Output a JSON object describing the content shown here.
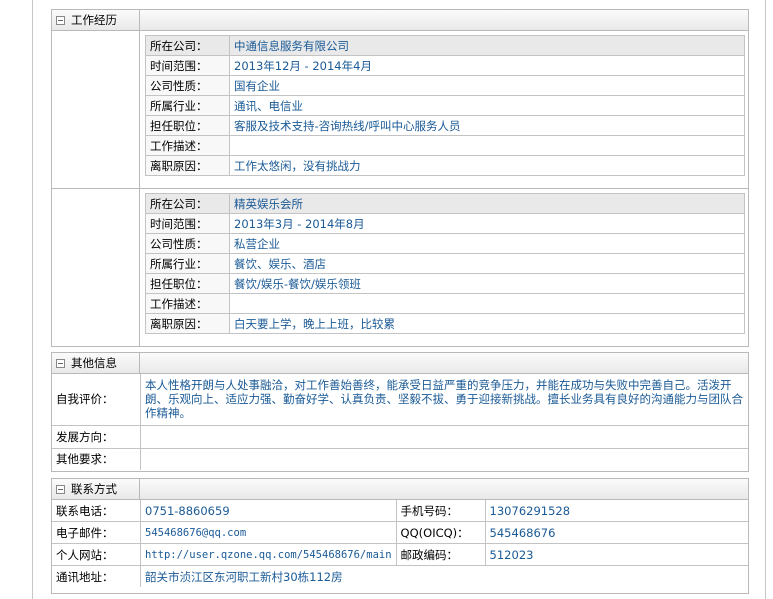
{
  "work": {
    "title": "工作经历",
    "jobs": [
      {
        "rows": [
          {
            "k": "所在公司：",
            "v": "中通信息服务有限公司"
          },
          {
            "k": "时间范围：",
            "v": "2013年12月 - 2014年4月"
          },
          {
            "k": "公司性质：",
            "v": "国有企业"
          },
          {
            "k": "所属行业：",
            "v": "通讯、电信业"
          },
          {
            "k": "担任职位：",
            "v": "客服及技术支持-咨询热线/呼叫中心服务人员"
          },
          {
            "k": "工作描述：",
            "v": ""
          },
          {
            "k": "离职原因：",
            "v": "工作太悠闲，没有挑战力"
          }
        ]
      },
      {
        "rows": [
          {
            "k": "所在公司：",
            "v": "精英娱乐会所"
          },
          {
            "k": "时间范围：",
            "v": "2013年3月 - 2014年8月"
          },
          {
            "k": "公司性质：",
            "v": "私营企业"
          },
          {
            "k": "所属行业：",
            "v": "餐饮、娱乐、酒店"
          },
          {
            "k": "担任职位：",
            "v": "餐饮/娱乐-餐饮/娱乐领班"
          },
          {
            "k": "工作描述：",
            "v": ""
          },
          {
            "k": "离职原因：",
            "v": "白天要上学，晚上上班，比较累"
          }
        ]
      }
    ]
  },
  "other": {
    "title": "其他信息",
    "self_eval_label": "自我评价：",
    "self_eval": "本人性格开朗与人处事融洽，对工作善始善终，能承受日益严重的竞争压力，并能在成功与失败中完善自己。活泼开朗、乐观向上、适应力强、勤奋好学、认真负责、坚毅不拔、勇于迎接新挑战。擅长业务具有良好的沟通能力与团队合作精神。",
    "direction_label": "发展方向：",
    "other_req_label": "其他要求："
  },
  "contact": {
    "title": "联系方式",
    "phone_label": "联系电话：",
    "phone": "0751-8860659",
    "mobile_label": "手机号码：",
    "mobile": "13076291528",
    "email_label": "电子邮件：",
    "email": "545468676@qq.com",
    "qq_label": "QQ(OICQ)：",
    "qq": "545468676",
    "site_label": "个人网站：",
    "site": "http://user.qzone.qq.com/545468676/main",
    "zip_label": "邮政编码：",
    "zip": "512023",
    "addr_label": "通讯地址：",
    "addr": "韶关市浈江区东河职工新村30栋112房"
  }
}
